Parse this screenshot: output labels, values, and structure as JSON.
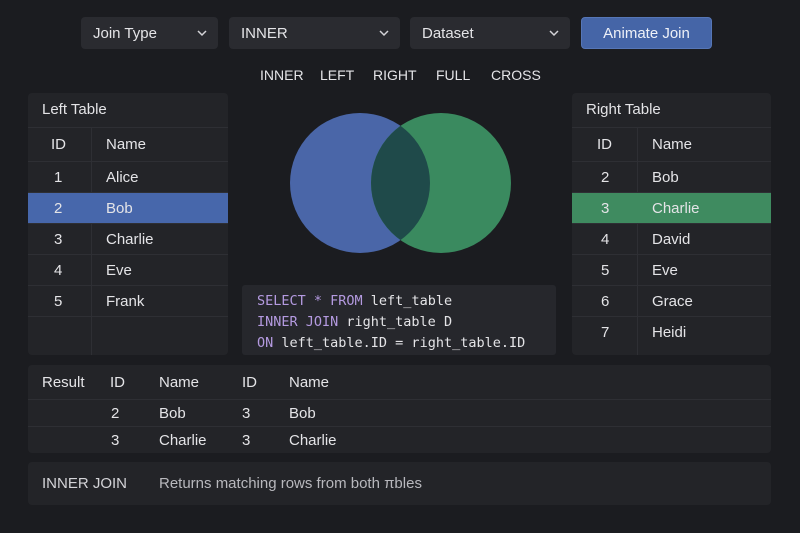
{
  "controls": {
    "join_type_label": "Join Type",
    "join_value": "INNER",
    "dataset_label": "Dataset",
    "animate_label": "Animate Join"
  },
  "tabs": [
    "INNER",
    "LEFT",
    "RIGHT",
    "FULL",
    "CROSS"
  ],
  "left_table": {
    "title": "Left Table",
    "headers": {
      "id": "ID",
      "name": "Name"
    },
    "rows": [
      {
        "id": "1",
        "name": "Alice"
      },
      {
        "id": "2",
        "name": "Bob"
      },
      {
        "id": "3",
        "name": "Charlie"
      },
      {
        "id": "4",
        "name": "Eve"
      },
      {
        "id": "5",
        "name": "Frank"
      }
    ],
    "highlight_color": "#4767ab"
  },
  "right_table": {
    "title": "Right Table",
    "headers": {
      "id": "ID",
      "name": "Name"
    },
    "rows": [
      {
        "id": "2",
        "name": "Bob"
      },
      {
        "id": "3",
        "name": "Charlie"
      },
      {
        "id": "4",
        "name": "David"
      },
      {
        "id": "5",
        "name": "Eve"
      },
      {
        "id": "6",
        "name": "Grace"
      },
      {
        "id": "7",
        "name": "Heidi"
      }
    ],
    "highlight_color": "#3f8b60"
  },
  "venn": {
    "left_color": "#4a66a8",
    "right_color": "#3a8a5f",
    "overlap_color": "#1f4a4a"
  },
  "sql": {
    "line1_kw": "SELECT * FROM",
    "line1_rest": " left_table",
    "line2_kw": "INNER JOIN",
    "line2_rest": " right_table D",
    "line3_kw": "ON",
    "line3_rest": " left_table.ID = right_table.ID"
  },
  "result": {
    "label": "Result",
    "headers": {
      "id1": "ID",
      "name1": "Name",
      "id2": "ID",
      "name2": "Name"
    },
    "rows": [
      {
        "id1": "2",
        "name1": "Bob",
        "id2": "3",
        "name2": "Bob"
      },
      {
        "id1": "3",
        "name1": "Charlie",
        "id2": "3",
        "name2": "Charlie"
      }
    ]
  },
  "footer": {
    "join_name": "INNER JOIN",
    "description": "Returns matching rows from both πbles"
  }
}
